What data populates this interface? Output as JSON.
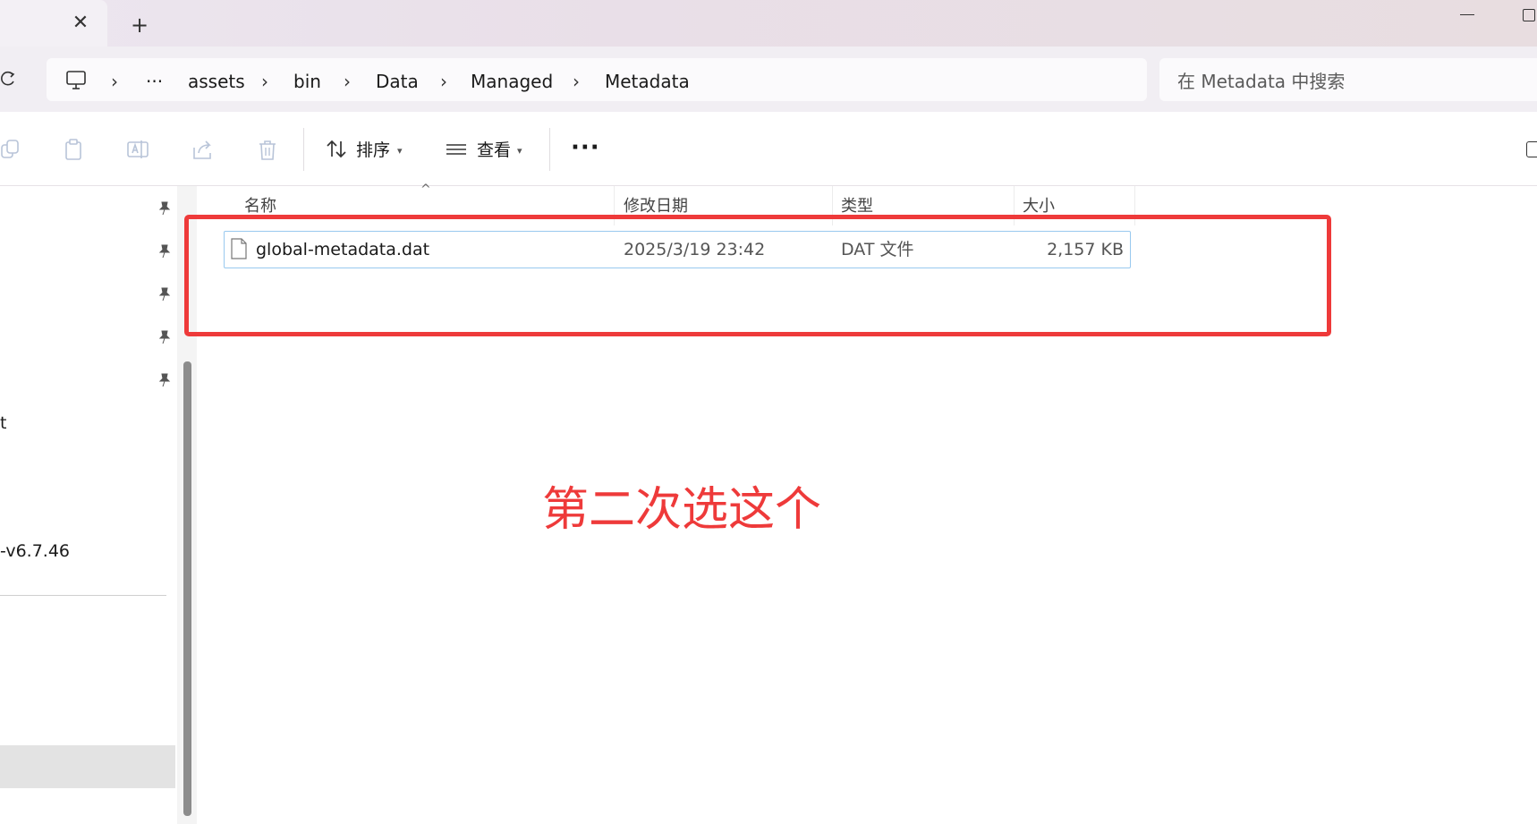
{
  "tabs": {
    "close_icon": "close-icon",
    "new_tab_icon": "plus-icon"
  },
  "window": {
    "minimize_icon": "minimize-icon",
    "maximize_icon": "maximize-icon"
  },
  "address": {
    "root_icon": "this-pc-icon",
    "overflow": "···",
    "separator": "›",
    "crumbs": [
      "assets",
      "bin",
      "Data",
      "Managed",
      "Metadata"
    ]
  },
  "search": {
    "placeholder": "在 Metadata 中搜索"
  },
  "toolbar": {
    "sort_label": "排序",
    "view_label": "查看",
    "more_label": "···"
  },
  "navpane": {
    "items": [
      {
        "label": "t"
      },
      {
        "label": "-v6.7.46"
      }
    ]
  },
  "columns": {
    "name": "名称",
    "date": "修改日期",
    "type": "类型",
    "size": "大小"
  },
  "files": [
    {
      "name": "global-metadata.dat",
      "modified": "2025/3/19 23:42",
      "type": "DAT 文件",
      "size": "2,157 KB"
    }
  ],
  "annotation": {
    "text": "第二次选这个",
    "color": "#ee3a3a"
  },
  "colors": {
    "accent": "#99c9ef",
    "annotation": "#ee3a3a"
  }
}
